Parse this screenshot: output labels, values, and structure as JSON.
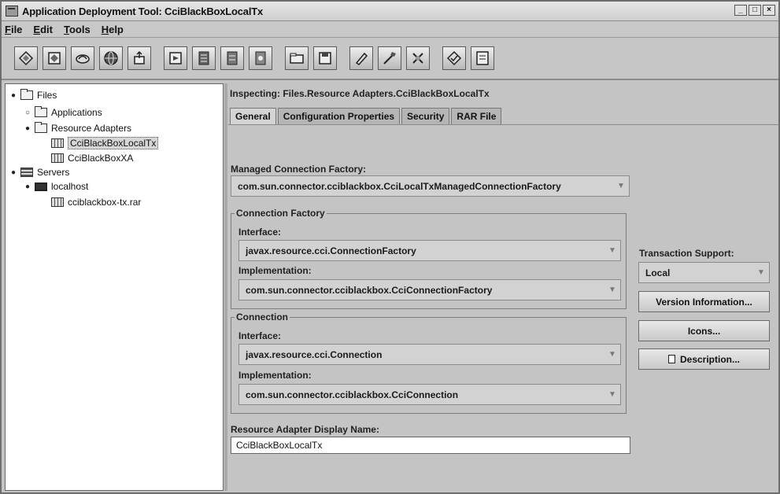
{
  "window": {
    "title": "Application Deployment Tool: CciBlackBoxLocalTx",
    "controls": [
      "_",
      "□",
      "×"
    ]
  },
  "menubar": {
    "items": [
      "File",
      "Edit",
      "Tools",
      "Help"
    ]
  },
  "toolbar": {
    "buttons": [
      "new-app-icon",
      "new-rar-icon",
      "add-icon",
      "globe-icon",
      "deploy-icon",
      "open-icon",
      "server-add-icon",
      "server-remove-icon",
      "server-update-icon",
      "folder-icon",
      "save-icon",
      "edit-icon",
      "wizard-icon",
      "tools-icon",
      "verify-icon",
      "properties-icon"
    ]
  },
  "tree": {
    "files": "Files",
    "applications": "Applications",
    "resource_adapters": "Resource Adapters",
    "rar1": "CciBlackBoxLocalTx",
    "rar2": "CciBlackBoxXA",
    "servers": "Servers",
    "localhost": "localhost",
    "deployed_rar": "cciblackbox-tx.rar"
  },
  "inspector": {
    "heading": "Inspecting: Files.Resource Adapters.CciBlackBoxLocalTx",
    "tabs": [
      "General",
      "Configuration Properties",
      "Security",
      "RAR File"
    ],
    "managed_factory_label": "Managed Connection Factory:",
    "managed_factory_value": "com.sun.connector.cciblackbox.CciLocalTxManagedConnectionFactory",
    "connection_factory_group": "Connection Factory",
    "cf_interface_label": "Interface:",
    "cf_interface_value": "javax.resource.cci.ConnectionFactory",
    "cf_impl_label": "Implementation:",
    "cf_impl_value": "com.sun.connector.cciblackbox.CciConnectionFactory",
    "connection_group": "Connection",
    "c_interface_label": "Interface:",
    "c_interface_value": "javax.resource.cci.Connection",
    "c_impl_label": "Implementation:",
    "c_impl_value": "com.sun.connector.cciblackbox.CciConnection",
    "display_name_label": "Resource Adapter Display Name:",
    "display_name_value": "CciBlackBoxLocalTx",
    "transaction_label": "Transaction Support:",
    "transaction_value": "Local",
    "version_button": "Version Information...",
    "icons_button": "Icons...",
    "description_button": "Description..."
  }
}
